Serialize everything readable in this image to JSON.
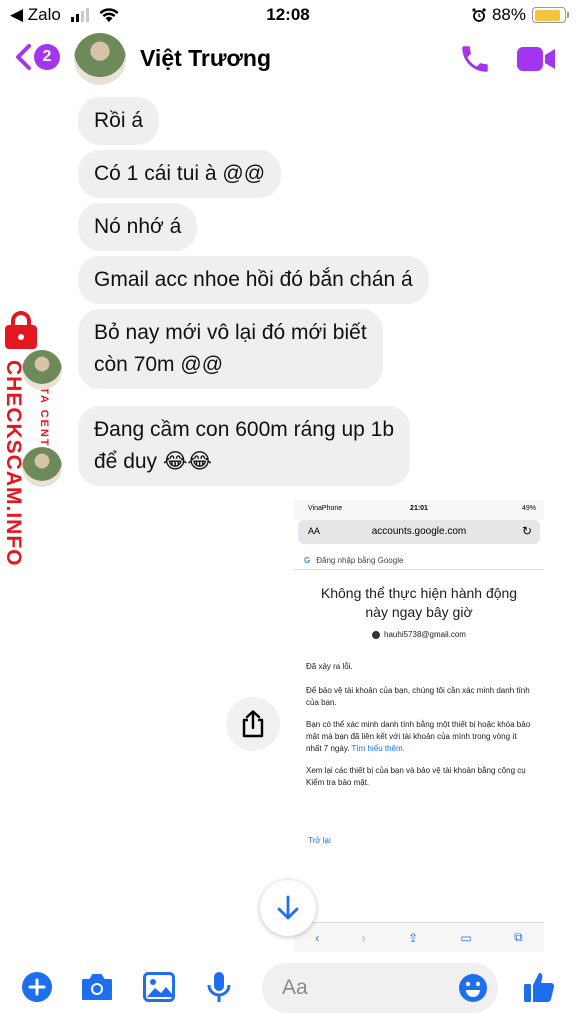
{
  "status_bar": {
    "back_app": "◀ Zalo",
    "time": "12:08",
    "battery": "88%"
  },
  "header": {
    "unread_count": "2",
    "contact_name": "Việt Trương"
  },
  "messages": [
    {
      "lines": [
        "Rồi á"
      ]
    },
    {
      "lines": [
        "Có 1 cái tui à @@"
      ]
    },
    {
      "lines": [
        "Nó nhớ á"
      ]
    },
    {
      "lines": [
        "Gmail acc nhoe hồi đó bắn chán á"
      ]
    },
    {
      "lines": [
        "Bỏ nay mới vô lại đó mới biết",
        "còn 70m @@"
      ]
    },
    {
      "lines": [
        "Đang cầm con 600m ráng up 1b",
        "để duy 😂😂"
      ]
    }
  ],
  "watermark": {
    "main": "CHECKSCAM.INFO",
    "sub": "DATA CENTER"
  },
  "attachment": {
    "status_carrier": "VinaPhone",
    "status_time": "21:01",
    "status_battery": "49%",
    "url_aa": "AA",
    "url": "accounts.google.com",
    "google_bar": "Đăng nhập bằng Google",
    "title": "Không thể thực hiện hành động này ngay bây giờ",
    "account": "hauhi5738@gmail.com",
    "p1": "Đã xảy ra lỗi.",
    "p2": "Để bảo vệ tài khoản của bạn, chúng tôi cần xác minh danh tính của bạn.",
    "p3": "Bạn có thể xác minh danh tính bằng một thiết bị hoặc khóa bảo mật mà bạn đã liên kết với tài khoản của mình trong vòng ít nhất 7 ngày.",
    "p3_link": "Tìm hiểu thêm.",
    "p4": "Xem lại các thiết bị của bạn và bảo vệ tài khoản bằng công cụ Kiểm tra bảo mật.",
    "back_link": "Trở lại"
  },
  "composer": {
    "placeholder": "Aa"
  },
  "colors": {
    "accent": "#a335ee",
    "composer_blue": "#1e6ff0",
    "bubble": "#efefef",
    "watermark": "#e3171f"
  }
}
